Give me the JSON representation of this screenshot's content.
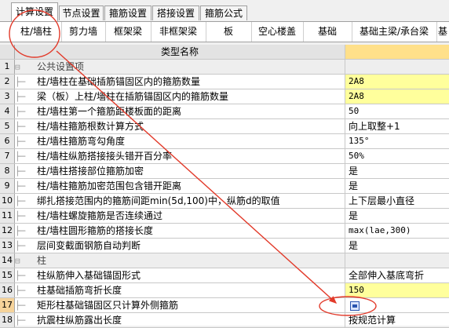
{
  "top_tabs": [
    "计算设置",
    "节点设置",
    "箍筋设置",
    "搭接设置",
    "箍筋公式"
  ],
  "sub_tabs": [
    "柱/墙柱",
    "剪力墙",
    "框架梁",
    "非框架梁",
    "板",
    "空心楼盖",
    "基础",
    "基础主梁/承台梁",
    "基"
  ],
  "grid": {
    "header_name": "类型名称",
    "rows": [
      {
        "num": "1",
        "name": "公共设置项",
        "value": "",
        "group": true
      },
      {
        "num": "2",
        "name": "柱/墙柱在基础插筋锚固区内的箍筋数量",
        "value": "2A8",
        "yellow": true
      },
      {
        "num": "3",
        "name": "梁（板）上柱/墙柱在插筋锚固区内的箍筋数量",
        "value": "2A8",
        "yellow": true
      },
      {
        "num": "4",
        "name": "柱/墙柱第一个箍筋距楼板面的距离",
        "value": "50"
      },
      {
        "num": "5",
        "name": "柱/墙柱箍筋根数计算方式",
        "value": "向上取整+1"
      },
      {
        "num": "6",
        "name": "柱/墙柱箍筋弯勾角度",
        "value": "135°"
      },
      {
        "num": "7",
        "name": "柱/墙柱纵筋搭接接头错开百分率",
        "value": "50%"
      },
      {
        "num": "8",
        "name": "柱/墙柱搭接部位箍筋加密",
        "value": "是"
      },
      {
        "num": "9",
        "name": "柱/墙柱箍筋加密范围包含错开距离",
        "value": "是"
      },
      {
        "num": "10",
        "name": "绑扎搭接范围内的箍筋间距min(5d,100)中，纵筋d的取值",
        "value": "上下层最小直径"
      },
      {
        "num": "11",
        "name": "柱/墙柱螺旋箍筋是否连续通过",
        "value": "是"
      },
      {
        "num": "12",
        "name": "柱/墙柱圆形箍筋的搭接长度",
        "value": "max(lae,300)"
      },
      {
        "num": "13",
        "name": "层间变截面钢筋自动判断",
        "value": "是"
      },
      {
        "num": "14",
        "name": "柱",
        "value": "",
        "group": true
      },
      {
        "num": "15",
        "name": "柱纵筋伸入基础锚固形式",
        "value": "全部伸入基底弯折"
      },
      {
        "num": "16",
        "name": "柱基础插筋弯折长度",
        "value": "150",
        "yellow": true
      },
      {
        "num": "17",
        "name": "矩形柱基础锚固区只计算外侧箍筋",
        "value": "",
        "selected": true
      },
      {
        "num": "18",
        "name": "抗震柱纵筋露出长度",
        "value": "按规范计算"
      }
    ]
  },
  "colors": {
    "accent_red": "#e23a2a",
    "header_yellow": "#ffe08a",
    "cell_yellow": "#ffff9c"
  }
}
